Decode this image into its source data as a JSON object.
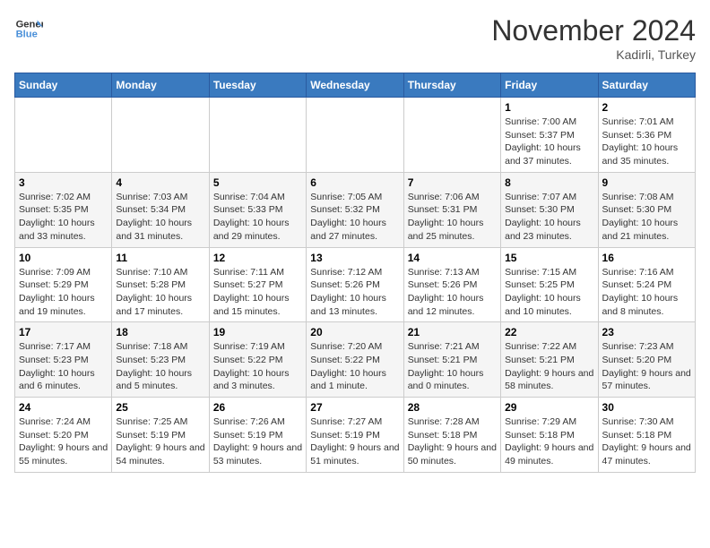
{
  "header": {
    "logo_line1": "General",
    "logo_line2": "Blue",
    "month": "November 2024",
    "location": "Kadirli, Turkey"
  },
  "weekdays": [
    "Sunday",
    "Monday",
    "Tuesday",
    "Wednesday",
    "Thursday",
    "Friday",
    "Saturday"
  ],
  "weeks": [
    [
      {
        "day": "",
        "info": ""
      },
      {
        "day": "",
        "info": ""
      },
      {
        "day": "",
        "info": ""
      },
      {
        "day": "",
        "info": ""
      },
      {
        "day": "",
        "info": ""
      },
      {
        "day": "1",
        "info": "Sunrise: 7:00 AM\nSunset: 5:37 PM\nDaylight: 10 hours and 37 minutes."
      },
      {
        "day": "2",
        "info": "Sunrise: 7:01 AM\nSunset: 5:36 PM\nDaylight: 10 hours and 35 minutes."
      }
    ],
    [
      {
        "day": "3",
        "info": "Sunrise: 7:02 AM\nSunset: 5:35 PM\nDaylight: 10 hours and 33 minutes."
      },
      {
        "day": "4",
        "info": "Sunrise: 7:03 AM\nSunset: 5:34 PM\nDaylight: 10 hours and 31 minutes."
      },
      {
        "day": "5",
        "info": "Sunrise: 7:04 AM\nSunset: 5:33 PM\nDaylight: 10 hours and 29 minutes."
      },
      {
        "day": "6",
        "info": "Sunrise: 7:05 AM\nSunset: 5:32 PM\nDaylight: 10 hours and 27 minutes."
      },
      {
        "day": "7",
        "info": "Sunrise: 7:06 AM\nSunset: 5:31 PM\nDaylight: 10 hours and 25 minutes."
      },
      {
        "day": "8",
        "info": "Sunrise: 7:07 AM\nSunset: 5:30 PM\nDaylight: 10 hours and 23 minutes."
      },
      {
        "day": "9",
        "info": "Sunrise: 7:08 AM\nSunset: 5:30 PM\nDaylight: 10 hours and 21 minutes."
      }
    ],
    [
      {
        "day": "10",
        "info": "Sunrise: 7:09 AM\nSunset: 5:29 PM\nDaylight: 10 hours and 19 minutes."
      },
      {
        "day": "11",
        "info": "Sunrise: 7:10 AM\nSunset: 5:28 PM\nDaylight: 10 hours and 17 minutes."
      },
      {
        "day": "12",
        "info": "Sunrise: 7:11 AM\nSunset: 5:27 PM\nDaylight: 10 hours and 15 minutes."
      },
      {
        "day": "13",
        "info": "Sunrise: 7:12 AM\nSunset: 5:26 PM\nDaylight: 10 hours and 13 minutes."
      },
      {
        "day": "14",
        "info": "Sunrise: 7:13 AM\nSunset: 5:26 PM\nDaylight: 10 hours and 12 minutes."
      },
      {
        "day": "15",
        "info": "Sunrise: 7:15 AM\nSunset: 5:25 PM\nDaylight: 10 hours and 10 minutes."
      },
      {
        "day": "16",
        "info": "Sunrise: 7:16 AM\nSunset: 5:24 PM\nDaylight: 10 hours and 8 minutes."
      }
    ],
    [
      {
        "day": "17",
        "info": "Sunrise: 7:17 AM\nSunset: 5:23 PM\nDaylight: 10 hours and 6 minutes."
      },
      {
        "day": "18",
        "info": "Sunrise: 7:18 AM\nSunset: 5:23 PM\nDaylight: 10 hours and 5 minutes."
      },
      {
        "day": "19",
        "info": "Sunrise: 7:19 AM\nSunset: 5:22 PM\nDaylight: 10 hours and 3 minutes."
      },
      {
        "day": "20",
        "info": "Sunrise: 7:20 AM\nSunset: 5:22 PM\nDaylight: 10 hours and 1 minute."
      },
      {
        "day": "21",
        "info": "Sunrise: 7:21 AM\nSunset: 5:21 PM\nDaylight: 10 hours and 0 minutes."
      },
      {
        "day": "22",
        "info": "Sunrise: 7:22 AM\nSunset: 5:21 PM\nDaylight: 9 hours and 58 minutes."
      },
      {
        "day": "23",
        "info": "Sunrise: 7:23 AM\nSunset: 5:20 PM\nDaylight: 9 hours and 57 minutes."
      }
    ],
    [
      {
        "day": "24",
        "info": "Sunrise: 7:24 AM\nSunset: 5:20 PM\nDaylight: 9 hours and 55 minutes."
      },
      {
        "day": "25",
        "info": "Sunrise: 7:25 AM\nSunset: 5:19 PM\nDaylight: 9 hours and 54 minutes."
      },
      {
        "day": "26",
        "info": "Sunrise: 7:26 AM\nSunset: 5:19 PM\nDaylight: 9 hours and 53 minutes."
      },
      {
        "day": "27",
        "info": "Sunrise: 7:27 AM\nSunset: 5:19 PM\nDaylight: 9 hours and 51 minutes."
      },
      {
        "day": "28",
        "info": "Sunrise: 7:28 AM\nSunset: 5:18 PM\nDaylight: 9 hours and 50 minutes."
      },
      {
        "day": "29",
        "info": "Sunrise: 7:29 AM\nSunset: 5:18 PM\nDaylight: 9 hours and 49 minutes."
      },
      {
        "day": "30",
        "info": "Sunrise: 7:30 AM\nSunset: 5:18 PM\nDaylight: 9 hours and 47 minutes."
      }
    ]
  ]
}
